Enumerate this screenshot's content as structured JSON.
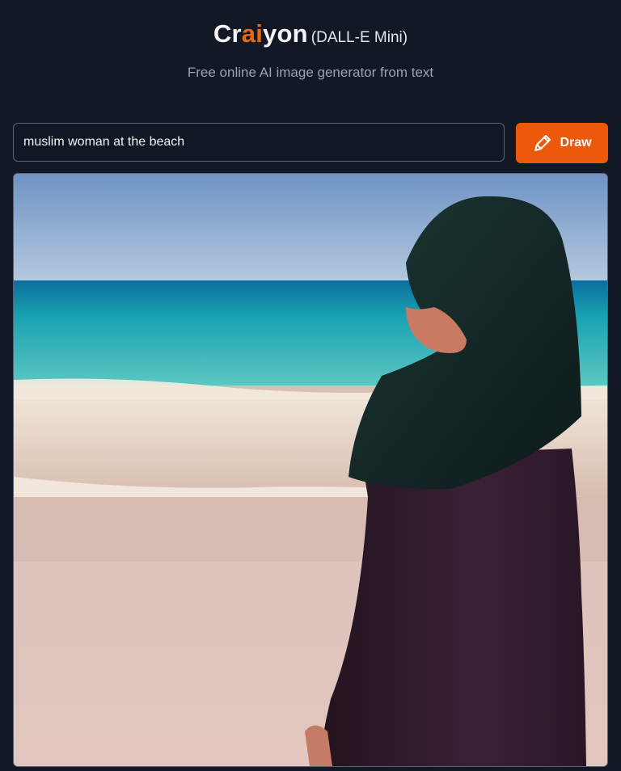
{
  "header": {
    "brand_prefix": "Cr",
    "brand_accent": "ai",
    "brand_suffix": "yon",
    "model_label": "(DALL-E Mini)",
    "subtitle": "Free online AI image generator from text"
  },
  "prompt": {
    "value": "muslim woman at the beach"
  },
  "draw_button": {
    "label": "Draw",
    "icon": "pencil-icon"
  },
  "result": {
    "image_description_icon": "generated-image"
  },
  "colors": {
    "background": "#131826",
    "accent": "#ea6a12",
    "button": "#ec580c"
  }
}
